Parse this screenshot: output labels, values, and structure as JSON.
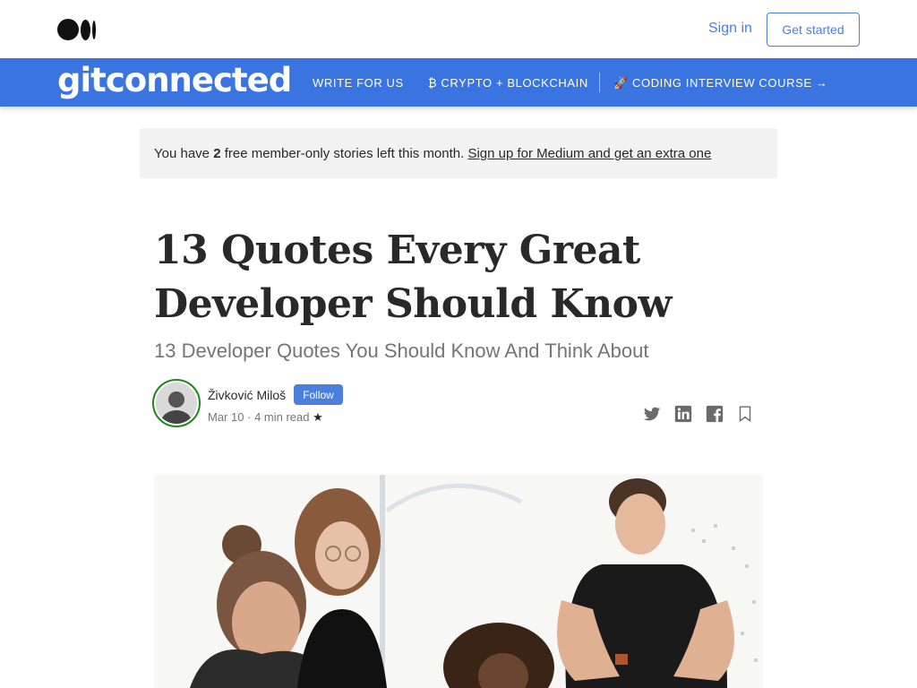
{
  "header": {
    "sign_in": "Sign in",
    "get_started": "Get started"
  },
  "publication": {
    "name": "gitconnected",
    "nav": [
      {
        "label": "WRITE FOR US"
      },
      {
        "label": "₿ CRYPTO + BLOCKCHAIN"
      },
      {
        "label": "🚀 CODING INTERVIEW COURSE →"
      }
    ],
    "accent_color": "#3a74e0"
  },
  "meter": {
    "prefix": "You have ",
    "count": "2",
    "suffix": " free member-only stories left this month. ",
    "link": "Sign up for Medium and get an extra one"
  },
  "article": {
    "title": "13 Quotes Every Great Developer Should Know",
    "subtitle": "13 Developer Quotes You Should Know And Think About",
    "author": {
      "name": "Živković Miloš",
      "follow": "Follow",
      "date": "Mar 10",
      "separator": "·",
      "read_time": "4 min read",
      "star": "★"
    }
  },
  "share_icons": [
    "twitter-icon",
    "linkedin-icon",
    "facebook-icon",
    "bookmark-icon"
  ]
}
